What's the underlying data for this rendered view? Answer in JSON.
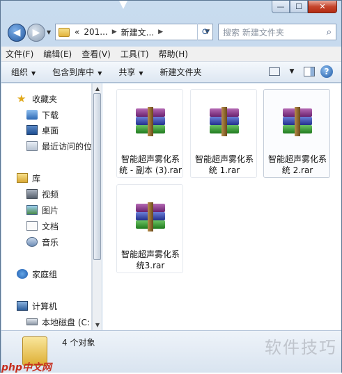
{
  "address": {
    "overflow": "«",
    "crumbs": [
      "201...",
      "新建文..."
    ],
    "search_placeholder": "搜索 新建文件夹"
  },
  "menu": [
    "文件(F)",
    "编辑(E)",
    "查看(V)",
    "工具(T)",
    "帮助(H)"
  ],
  "toolbar": {
    "organize": "组织",
    "include_library": "包含到库中",
    "share": "共享",
    "new_folder": "新建文件夹"
  },
  "nav": {
    "favorites": "收藏夹",
    "downloads": "下载",
    "desktop": "桌面",
    "recent": "最近访问的位",
    "libraries": "库",
    "videos": "视频",
    "pictures": "图片",
    "documents": "文档",
    "music": "音乐",
    "homegroup": "家庭组",
    "computer": "计算机",
    "local_disk": "本地磁盘 (C:"
  },
  "files": [
    {
      "line1": "智能超声雾化系",
      "line2": "统 - 副本 (3).rar"
    },
    {
      "line1": "智能超声雾化系",
      "line2": "统 1.rar"
    },
    {
      "line1": "智能超声雾化系",
      "line2": "统 2.rar"
    },
    {
      "line1": "智能超声雾化系",
      "line2": "统3.rar"
    }
  ],
  "status": {
    "count": "4 个对象"
  },
  "watermark": "软件技巧",
  "logo": "php中文网",
  "colors": {
    "accent": "#2c68b3",
    "window_frame": "#c9dcef"
  }
}
